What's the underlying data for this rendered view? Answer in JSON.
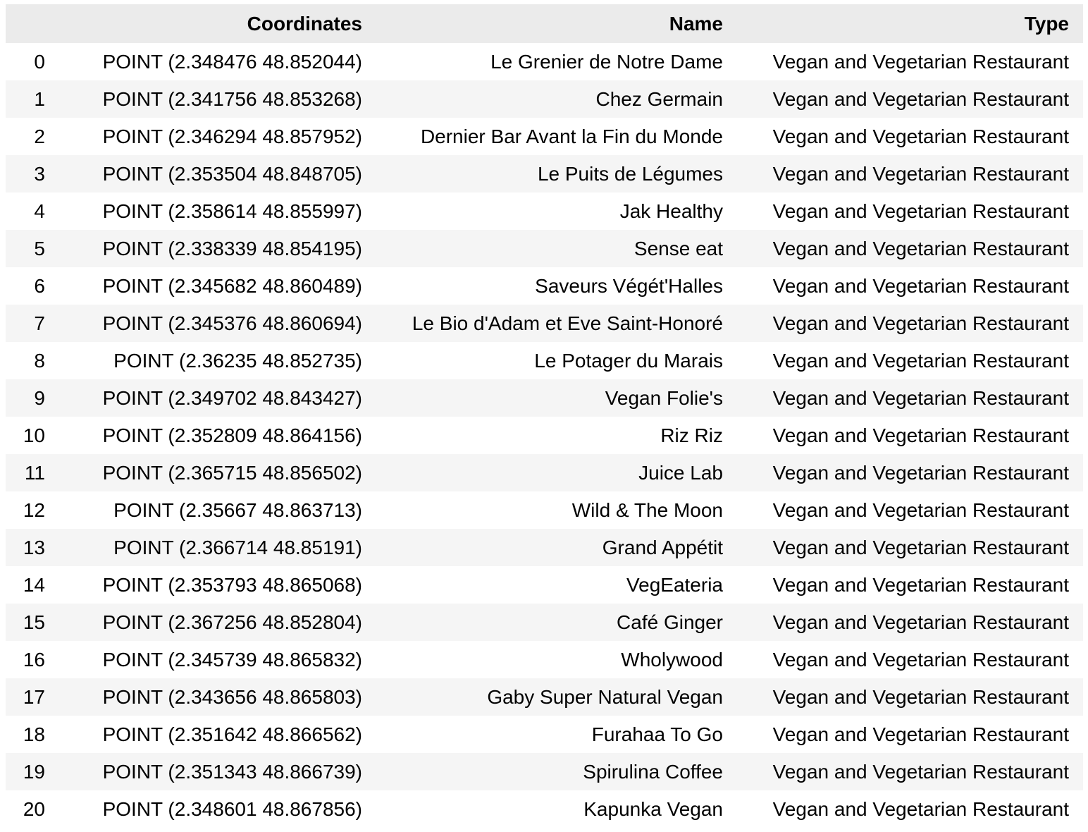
{
  "table": {
    "columns": {
      "index": "",
      "coordinates": "Coordinates",
      "name": "Name",
      "type": "Type"
    },
    "rows": [
      {
        "index": "0",
        "coordinates": "POINT (2.348476 48.852044)",
        "name": "Le Grenier de Notre Dame",
        "type": "Vegan and Vegetarian Restaurant"
      },
      {
        "index": "1",
        "coordinates": "POINT (2.341756 48.853268)",
        "name": "Chez Germain",
        "type": "Vegan and Vegetarian Restaurant"
      },
      {
        "index": "2",
        "coordinates": "POINT (2.346294 48.857952)",
        "name": "Dernier Bar Avant la Fin du Monde",
        "type": "Vegan and Vegetarian Restaurant"
      },
      {
        "index": "3",
        "coordinates": "POINT (2.353504 48.848705)",
        "name": "Le Puits de Légumes",
        "type": "Vegan and Vegetarian Restaurant"
      },
      {
        "index": "4",
        "coordinates": "POINT (2.358614 48.855997)",
        "name": "Jak Healthy",
        "type": "Vegan and Vegetarian Restaurant"
      },
      {
        "index": "5",
        "coordinates": "POINT (2.338339 48.854195)",
        "name": "Sense eat",
        "type": "Vegan and Vegetarian Restaurant"
      },
      {
        "index": "6",
        "coordinates": "POINT (2.345682 48.860489)",
        "name": "Saveurs Végét'Halles",
        "type": "Vegan and Vegetarian Restaurant"
      },
      {
        "index": "7",
        "coordinates": "POINT (2.345376 48.860694)",
        "name": "Le Bio d'Adam et Eve Saint-Honoré",
        "type": "Vegan and Vegetarian Restaurant"
      },
      {
        "index": "8",
        "coordinates": "POINT (2.36235 48.852735)",
        "name": "Le Potager du Marais",
        "type": "Vegan and Vegetarian Restaurant"
      },
      {
        "index": "9",
        "coordinates": "POINT (2.349702 48.843427)",
        "name": "Vegan Folie's",
        "type": "Vegan and Vegetarian Restaurant"
      },
      {
        "index": "10",
        "coordinates": "POINT (2.352809 48.864156)",
        "name": "Riz Riz",
        "type": "Vegan and Vegetarian Restaurant"
      },
      {
        "index": "11",
        "coordinates": "POINT (2.365715 48.856502)",
        "name": "Juice Lab",
        "type": "Vegan and Vegetarian Restaurant"
      },
      {
        "index": "12",
        "coordinates": "POINT (2.35667 48.863713)",
        "name": "Wild & The Moon",
        "type": "Vegan and Vegetarian Restaurant"
      },
      {
        "index": "13",
        "coordinates": "POINT (2.366714 48.85191)",
        "name": "Grand Appétit",
        "type": "Vegan and Vegetarian Restaurant"
      },
      {
        "index": "14",
        "coordinates": "POINT (2.353793 48.865068)",
        "name": "VegEateria",
        "type": "Vegan and Vegetarian Restaurant"
      },
      {
        "index": "15",
        "coordinates": "POINT (2.367256 48.852804)",
        "name": "Café Ginger",
        "type": "Vegan and Vegetarian Restaurant"
      },
      {
        "index": "16",
        "coordinates": "POINT (2.345739 48.865832)",
        "name": "Wholywood",
        "type": "Vegan and Vegetarian Restaurant"
      },
      {
        "index": "17",
        "coordinates": "POINT (2.343656 48.865803)",
        "name": "Gaby Super Natural Vegan",
        "type": "Vegan and Vegetarian Restaurant"
      },
      {
        "index": "18",
        "coordinates": "POINT (2.351642 48.866562)",
        "name": "Furahaa To Go",
        "type": "Vegan and Vegetarian Restaurant"
      },
      {
        "index": "19",
        "coordinates": "POINT (2.351343 48.866739)",
        "name": "Spirulina Coffee",
        "type": "Vegan and Vegetarian Restaurant"
      },
      {
        "index": "20",
        "coordinates": "POINT (2.348601 48.867856)",
        "name": "Kapunka Vegan",
        "type": "Vegan and Vegetarian Restaurant"
      }
    ]
  }
}
